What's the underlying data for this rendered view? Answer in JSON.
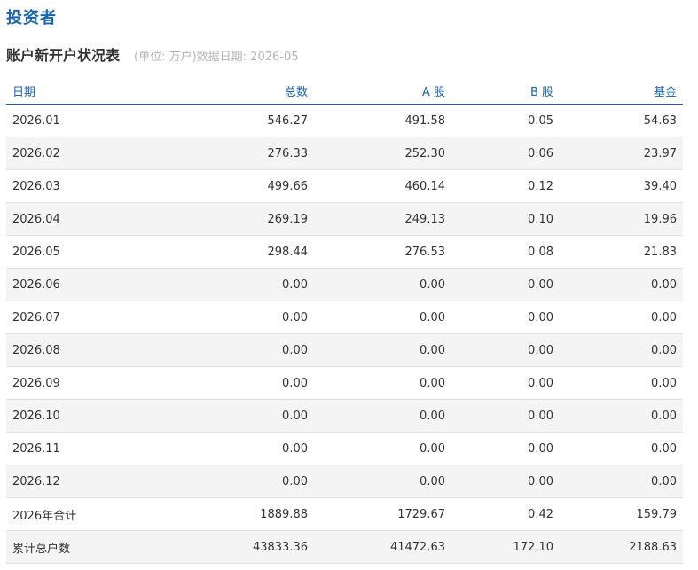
{
  "page": {
    "title": "投资者"
  },
  "table": {
    "title": "账户新开户状况表",
    "meta": "(单位: 万户)数据日期: 2026-05",
    "columns": [
      "日期",
      "总数",
      "A 股",
      "B 股",
      "基金"
    ],
    "rows": [
      [
        "2026.01",
        "546.27",
        "491.58",
        "0.05",
        "54.63"
      ],
      [
        "2026.02",
        "276.33",
        "252.30",
        "0.06",
        "23.97"
      ],
      [
        "2026.03",
        "499.66",
        "460.14",
        "0.12",
        "39.40"
      ],
      [
        "2026.04",
        "269.19",
        "249.13",
        "0.10",
        "19.96"
      ],
      [
        "2026.05",
        "298.44",
        "276.53",
        "0.08",
        "21.83"
      ],
      [
        "2026.06",
        "0.00",
        "0.00",
        "0.00",
        "0.00"
      ],
      [
        "2026.07",
        "0.00",
        "0.00",
        "0.00",
        "0.00"
      ],
      [
        "2026.08",
        "0.00",
        "0.00",
        "0.00",
        "0.00"
      ],
      [
        "2026.09",
        "0.00",
        "0.00",
        "0.00",
        "0.00"
      ],
      [
        "2026.10",
        "0.00",
        "0.00",
        "0.00",
        "0.00"
      ],
      [
        "2026.11",
        "0.00",
        "0.00",
        "0.00",
        "0.00"
      ],
      [
        "2026.12",
        "0.00",
        "0.00",
        "0.00",
        "0.00"
      ],
      [
        "2026年合计",
        "1889.88",
        "1729.67",
        "0.42",
        "159.79"
      ],
      [
        "累计总户数",
        "43833.36",
        "41472.63",
        "172.10",
        "2188.63"
      ]
    ]
  },
  "colors": {
    "accent": "#1b64b0",
    "text": "#333333",
    "muted": "#b5b5b5",
    "row_stripe": "#f4f4f4",
    "row_border": "#e2e2e2"
  }
}
